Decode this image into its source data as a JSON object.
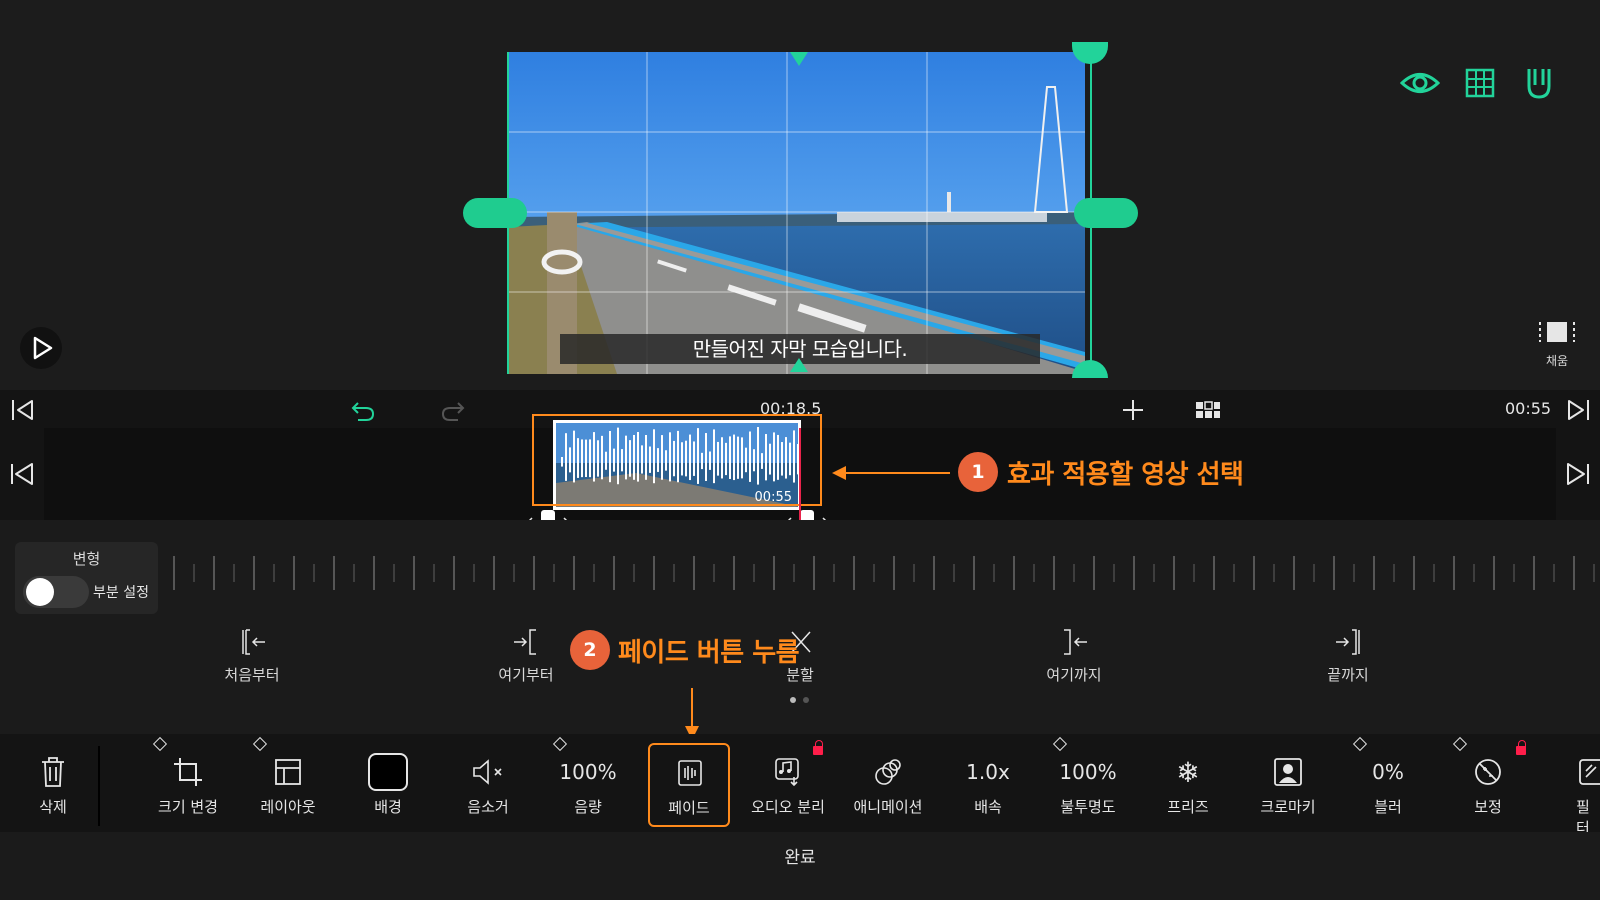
{
  "preview": {
    "subtitle": "만들어진 자막 모습입니다.",
    "fill_label": "채움",
    "colors": {
      "accent": "#22d39a",
      "annotation": "#ff8a1c"
    }
  },
  "transport": {
    "current_time": "00:18.5",
    "total_time": "00:55"
  },
  "clip": {
    "duration": "00:55"
  },
  "transform": {
    "title": "변형",
    "partial_label": "부분 설정"
  },
  "edit_actions": [
    {
      "label": "처음부터"
    },
    {
      "label": "여기부터"
    },
    {
      "label": "분할"
    },
    {
      "label": "여기까지"
    },
    {
      "label": "끝까지"
    }
  ],
  "toolbar": {
    "delete": "삭제",
    "resize": "크기 변경",
    "layout": "레이아웃",
    "background": "배경",
    "mute": "음소거",
    "volume_value": "100%",
    "volume": "음량",
    "fade": "페이드",
    "audio_split": "오디오 분리",
    "animation": "애니메이션",
    "speed_value": "1.0x",
    "speed": "배속",
    "opacity_value": "100%",
    "opacity": "불투명도",
    "freeze": "프리즈",
    "chromakey": "크로마키",
    "blur_value": "0%",
    "blur": "블러",
    "correction": "보정",
    "filter": "필터"
  },
  "footer": {
    "done": "완료"
  },
  "annotations": {
    "step1_num": "1",
    "step1_text": "효과 적용할 영상 선택",
    "step2_num": "2",
    "step2_text": "페이드 버튼 누름"
  }
}
